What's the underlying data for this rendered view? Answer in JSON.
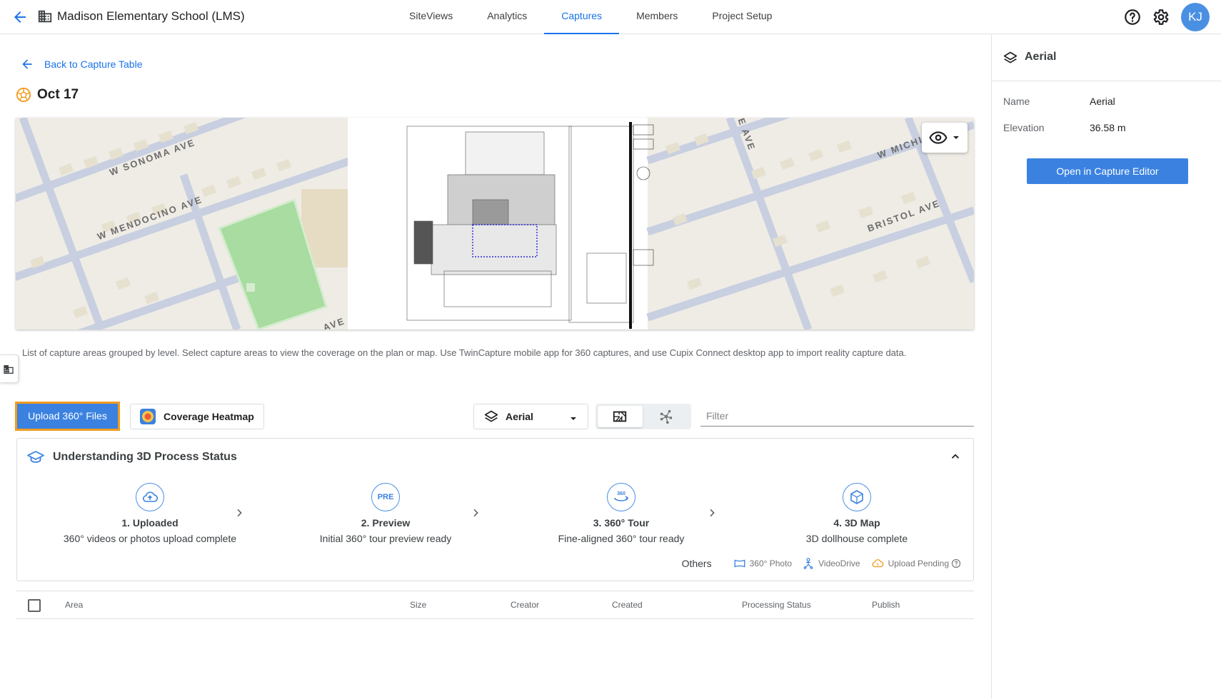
{
  "header": {
    "project_title": "Madison Elementary School (LMS)",
    "tabs": [
      "SiteViews",
      "Analytics",
      "Captures",
      "Members",
      "Project Setup"
    ],
    "active_tab": "Captures",
    "avatar_initials": "KJ",
    "icons": [
      "back-arrow-icon",
      "building-icon",
      "help-icon",
      "gear-icon"
    ]
  },
  "main": {
    "back_link": "Back to Capture Table",
    "capture_date": "Oct 17",
    "map": {
      "street_labels": [
        "W SONOMA AVE",
        "W MENDOCINO AVE",
        "W MICHIG",
        "BRISTOL AVE",
        "E AVE",
        "AVE"
      ]
    },
    "description": "List of capture areas grouped by level. Select capture areas to view the coverage on the plan or map. Use TwinCapture mobile app for 360 captures, and use Cupix Connect desktop app to import reality capture data.",
    "toolbar": {
      "upload_label": "Upload 360° Files",
      "heatmap_label": "Coverage Heatmap",
      "layer_selected": "Aerial",
      "filter_placeholder": "Filter"
    },
    "process": {
      "title": "Understanding 3D Process Status",
      "steps": [
        {
          "title": "1. Uploaded",
          "subtitle": "360° videos or photos upload complete"
        },
        {
          "title": "2. Preview",
          "subtitle": "Initial 360° tour preview ready",
          "badge": "PRE"
        },
        {
          "title": "3. 360° Tour",
          "subtitle": "Fine-aligned 360° tour ready",
          "badge": "360"
        },
        {
          "title": "4. 3D Map",
          "subtitle": "3D dollhouse complete"
        }
      ],
      "legend": {
        "others_label": "Others",
        "items": [
          "360° Photo",
          "VideoDrive",
          "Upload Pending"
        ]
      }
    },
    "table": {
      "columns": [
        "Area",
        "Size",
        "Creator",
        "Created",
        "Processing Status",
        "Publish"
      ]
    }
  },
  "right_panel": {
    "title": "Aerial",
    "fields": [
      {
        "label": "Name",
        "value": "Aerial"
      },
      {
        "label": "Elevation",
        "value": "36.58 m"
      }
    ],
    "button_label": "Open in Capture Editor"
  },
  "colors": {
    "accent": "#1a73e8",
    "button_blue": "#3b82e0",
    "highlight_orange": "#f29b1f",
    "park_green": "#a8dca0"
  }
}
